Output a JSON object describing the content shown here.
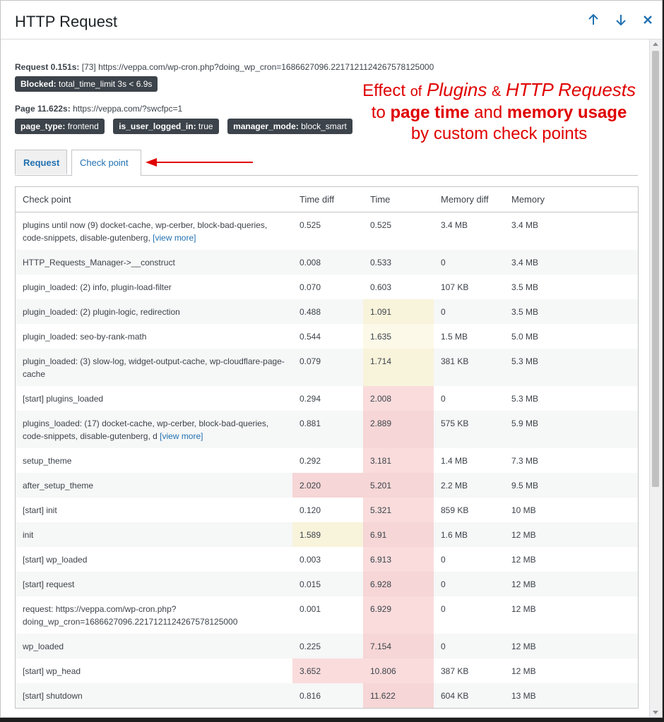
{
  "modal": {
    "title": "HTTP Request"
  },
  "request_info": {
    "label": "Request 0.151s:",
    "value": "[73] https://veppa.com/wp-cron.php?doing_wp_cron=1686627096.2217121124267578125000",
    "blocked_key": "Blocked:",
    "blocked_value": "total_time_limit 3s < 6.9s"
  },
  "page_info": {
    "label": "Page 11.622s:",
    "value": "https://veppa.com/?swcfpc=1",
    "badges": [
      {
        "key": "page_type:",
        "value": "frontend"
      },
      {
        "key": "is_user_logged_in:",
        "value": "true"
      },
      {
        "key": "manager_mode:",
        "value": "block_smart"
      }
    ]
  },
  "annotation": {
    "l1a": "Effect",
    "l1b": "of",
    "l1c": "Plugins",
    "l1d": "&",
    "l1e": "HTTP Requests",
    "l2a": "to",
    "l2b": "page time",
    "l2c": "and",
    "l2d": "memory usage",
    "l3": "by custom check points",
    "color": "#e00000"
  },
  "tabs": [
    {
      "label": "Request",
      "active": false
    },
    {
      "label": "Check point",
      "active": true
    }
  ],
  "table": {
    "headers": [
      "Check point",
      "Time diff",
      "Time",
      "Memory diff",
      "Memory"
    ],
    "rows": [
      {
        "cp": "plugins until now (9) docket-cache, wp-cerber, block-bad-queries, code-snippets, disable-gutenberg,",
        "more": "[view more]",
        "td": "0.525",
        "t": "0.525",
        "md": "3.4 MB",
        "m": "3.4 MB",
        "td_hl": "",
        "t_hl": ""
      },
      {
        "cp": "HTTP_Requests_Manager->__construct",
        "more": "",
        "td": "0.008",
        "t": "0.533",
        "md": "0",
        "m": "3.4 MB",
        "td_hl": "",
        "t_hl": ""
      },
      {
        "cp": "plugin_loaded: (2) info, plugin-load-filter",
        "more": "",
        "td": "0.070",
        "t": "0.603",
        "md": "107 KB",
        "m": "3.5 MB",
        "td_hl": "",
        "t_hl": ""
      },
      {
        "cp": "plugin_loaded: (2) plugin-logic, redirection",
        "more": "",
        "td": "0.488",
        "t": "1.091",
        "md": "0",
        "m": "3.5 MB",
        "td_hl": "",
        "t_hl": "yellow"
      },
      {
        "cp": "plugin_loaded: seo-by-rank-math",
        "more": "",
        "td": "0.544",
        "t": "1.635",
        "md": "1.5 MB",
        "m": "5.0 MB",
        "td_hl": "",
        "t_hl": "yellow"
      },
      {
        "cp": "plugin_loaded: (3) slow-log, widget-output-cache, wp-cloudflare-page-cache",
        "more": "",
        "td": "0.079",
        "t": "1.714",
        "md": "381 KB",
        "m": "5.3 MB",
        "td_hl": "",
        "t_hl": "yellow"
      },
      {
        "cp": "[start] plugins_loaded",
        "more": "",
        "td": "0.294",
        "t": "2.008",
        "md": "0",
        "m": "5.3 MB",
        "td_hl": "",
        "t_hl": "red"
      },
      {
        "cp": "plugins_loaded: (17) docket-cache, wp-cerber, block-bad-queries, code-snippets, disable-gutenberg, d",
        "more": "[view more]",
        "td": "0.881",
        "t": "2.889",
        "md": "575 KB",
        "m": "5.9 MB",
        "td_hl": "",
        "t_hl": "red"
      },
      {
        "cp": "setup_theme",
        "more": "",
        "td": "0.292",
        "t": "3.181",
        "md": "1.4 MB",
        "m": "7.3 MB",
        "td_hl": "",
        "t_hl": "red"
      },
      {
        "cp": "after_setup_theme",
        "more": "",
        "td": "2.020",
        "t": "5.201",
        "md": "2.2 MB",
        "m": "9.5 MB",
        "td_hl": "red",
        "t_hl": "red"
      },
      {
        "cp": "[start] init",
        "more": "",
        "td": "0.120",
        "t": "5.321",
        "md": "859 KB",
        "m": "10 MB",
        "td_hl": "",
        "t_hl": "red"
      },
      {
        "cp": "init",
        "more": "",
        "td": "1.589",
        "t": "6.91",
        "md": "1.6 MB",
        "m": "12 MB",
        "td_hl": "yellow",
        "t_hl": "red"
      },
      {
        "cp": "[start] wp_loaded",
        "more": "",
        "td": "0.003",
        "t": "6.913",
        "md": "0",
        "m": "12 MB",
        "td_hl": "",
        "t_hl": "red"
      },
      {
        "cp": "[start] request",
        "more": "",
        "td": "0.015",
        "t": "6.928",
        "md": "0",
        "m": "12 MB",
        "td_hl": "",
        "t_hl": "red"
      },
      {
        "cp": "request: https://veppa.com/wp-cron.php?doing_wp_cron=1686627096.2217121124267578125000",
        "more": "",
        "td": "0.001",
        "t": "6.929",
        "md": "0",
        "m": "12 MB",
        "td_hl": "",
        "t_hl": "red"
      },
      {
        "cp": "wp_loaded",
        "more": "",
        "td": "0.225",
        "t": "7.154",
        "md": "0",
        "m": "12 MB",
        "td_hl": "",
        "t_hl": "red"
      },
      {
        "cp": "[start] wp_head",
        "more": "",
        "td": "3.652",
        "t": "10.806",
        "md": "387 KB",
        "m": "12 MB",
        "td_hl": "red",
        "t_hl": "red"
      },
      {
        "cp": "[start] shutdown",
        "more": "",
        "td": "0.816",
        "t": "11.622",
        "md": "604 KB",
        "m": "13 MB",
        "td_hl": "",
        "t_hl": "red"
      }
    ]
  }
}
